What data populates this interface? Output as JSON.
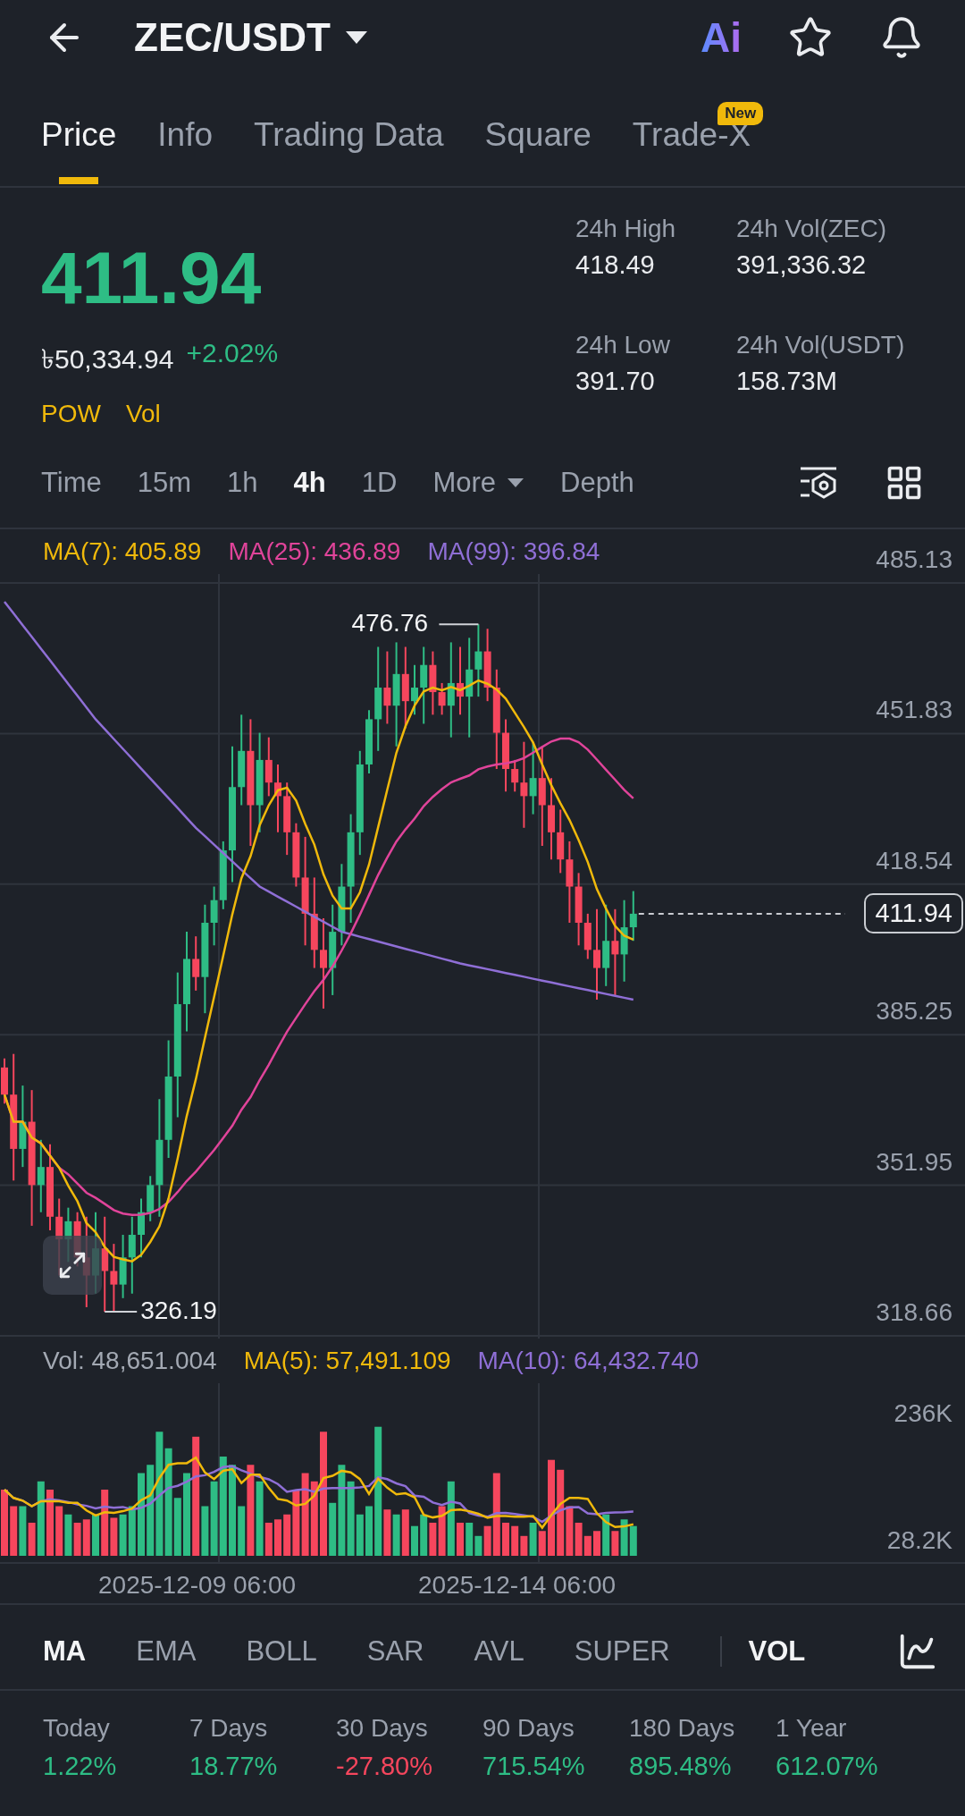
{
  "header": {
    "title": "ZEC/USDT",
    "ai_label": "Ai"
  },
  "tabs": [
    {
      "label": "Price",
      "selected": true
    },
    {
      "label": "Info",
      "selected": false
    },
    {
      "label": "Trading Data",
      "selected": false
    },
    {
      "label": "Square",
      "selected": false
    },
    {
      "label": "Trade-X",
      "selected": false,
      "badge": "New"
    }
  ],
  "ticker": {
    "last_price": "411.94",
    "local_price": "৳50,334.94",
    "change": "+2.02%",
    "tags": [
      "POW",
      "Vol"
    ]
  },
  "stats": [
    {
      "label": "24h High",
      "value": "418.49"
    },
    {
      "label": "24h Vol(ZEC)",
      "value": "391,336.32"
    },
    {
      "label": "24h Low",
      "value": "391.70"
    },
    {
      "label": "24h Vol(USDT)",
      "value": "158.73M"
    }
  ],
  "intervals": [
    {
      "label": "Time",
      "selected": false,
      "kind": "plain"
    },
    {
      "label": "15m",
      "selected": false,
      "kind": "plain"
    },
    {
      "label": "1h",
      "selected": false,
      "kind": "plain"
    },
    {
      "label": "4h",
      "selected": true,
      "kind": "plain"
    },
    {
      "label": "1D",
      "selected": false,
      "kind": "plain"
    },
    {
      "label": "More",
      "selected": false,
      "kind": "dropdown"
    },
    {
      "label": "Depth",
      "selected": false,
      "kind": "plain"
    }
  ],
  "price_chart": {
    "legend": [
      {
        "label": "MA(7): 405.89",
        "color": "#f0b90b"
      },
      {
        "label": "MA(25): 436.89",
        "color": "#e0449a"
      },
      {
        "label": "MA(99): 396.84",
        "color": "#8f6fd6"
      }
    ],
    "price_axis": [
      "485.13",
      "451.83",
      "418.54",
      "385.25",
      "351.95",
      "318.66"
    ],
    "current_price": "411.94",
    "high_marker": "476.76",
    "low_marker": "326.19"
  },
  "volume_chart": {
    "legend": [
      {
        "label": "Vol: 48,651.004",
        "color": "#a3a9b3"
      },
      {
        "label": "MA(5): 57,491.109",
        "color": "#f0b90b"
      },
      {
        "label": "MA(10): 64,432.740",
        "color": "#8f6fd6"
      }
    ],
    "axis": [
      "236K",
      "28.2K"
    ],
    "dates": [
      "2025-12-09 06:00",
      "2025-12-14 06:00"
    ]
  },
  "indicators": [
    {
      "label": "MA",
      "selected": true
    },
    {
      "label": "EMA",
      "selected": false
    },
    {
      "label": "BOLL",
      "selected": false
    },
    {
      "label": "SAR",
      "selected": false
    },
    {
      "label": "AVL",
      "selected": false
    },
    {
      "label": "SUPER",
      "selected": false
    },
    {
      "label": "VOL",
      "selected": true
    }
  ],
  "performance": [
    {
      "period": "Today",
      "change": "1.22%",
      "color": "#2ebd85"
    },
    {
      "period": "7 Days",
      "change": "18.77%",
      "color": "#2ebd85"
    },
    {
      "period": "30 Days",
      "change": "-27.80%",
      "color": "#f6465d"
    },
    {
      "period": "90 Days",
      "change": "715.54%",
      "color": "#2ebd85"
    },
    {
      "period": "180 Days",
      "change": "895.48%",
      "color": "#2ebd85"
    },
    {
      "period": "1 Year",
      "change": "612.07%",
      "color": "#2ebd85"
    }
  ]
}
